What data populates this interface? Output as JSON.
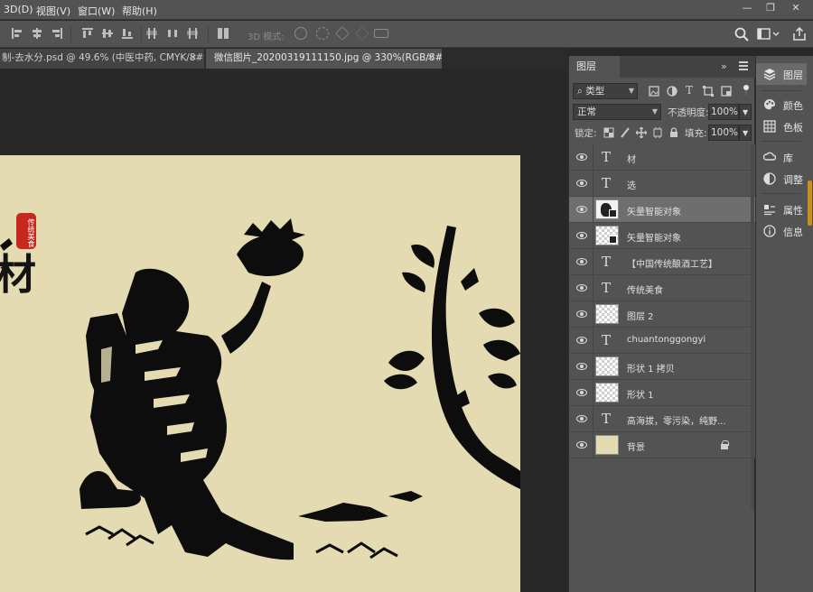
{
  "menu": {
    "items": [
      "3D(D)",
      "视图(V)",
      "窗口(W)",
      "帮助(H)"
    ]
  },
  "window_controls": {
    "minimize": "—",
    "restore": "❐",
    "close": "✕"
  },
  "options_bar": {
    "mode_3d_label": "3D 模式:"
  },
  "tabs": [
    {
      "label": "制-去水分.psd @ 49.6% (中医中药, CMYK/8#)",
      "close": "✕",
      "active": false
    },
    {
      "label": "微信图片_20200319111150.jpg @ 330%(RGB/8#) *",
      "close": "✕",
      "active": true
    }
  ],
  "document": {
    "title_text": "材",
    "seal_text": "传统美食",
    "background_color": "#e4dbb3"
  },
  "layers_panel": {
    "tab_label": "图层",
    "collapse_glyph": "»",
    "filter": {
      "label": "类型"
    },
    "blend_mode": "正常",
    "opacity_label": "不透明度:",
    "opacity_value": "100%",
    "lock_label": "锁定:",
    "fill_label": "填充:",
    "fill_value": "100%",
    "layers": [
      {
        "name": "材",
        "kind": "text",
        "selected": false
      },
      {
        "name": "选",
        "kind": "text",
        "selected": false
      },
      {
        "name": "矢量智能对象",
        "kind": "smart-art",
        "selected": true
      },
      {
        "name": "矢量智能对象",
        "kind": "smart",
        "selected": false
      },
      {
        "name": "【中国传统酿酒工艺】",
        "kind": "text",
        "selected": false
      },
      {
        "name": "传统美食",
        "kind": "text",
        "selected": false
      },
      {
        "name": "图层 2",
        "kind": "pixel",
        "selected": false
      },
      {
        "name": "chuantonggongyi",
        "kind": "text",
        "selected": false
      },
      {
        "name": "形状 1 拷贝",
        "kind": "shape",
        "selected": false
      },
      {
        "name": "形状 1",
        "kind": "shape",
        "selected": false
      },
      {
        "name": "高海拔，零污染，纯野...",
        "kind": "text",
        "selected": false
      },
      {
        "name": "背景",
        "kind": "background",
        "selected": false,
        "locked": true
      }
    ]
  },
  "right_dock": {
    "items": [
      {
        "label": "图层",
        "icon": "layers-icon",
        "active": true
      },
      {
        "label": "颜色",
        "icon": "color-palette-icon"
      },
      {
        "label": "色板",
        "icon": "swatches-icon"
      },
      {
        "label": "库",
        "icon": "libraries-icon"
      },
      {
        "label": "调整",
        "icon": "adjustments-icon"
      },
      {
        "label": "属性",
        "icon": "properties-icon"
      },
      {
        "label": "信息",
        "icon": "info-icon"
      }
    ]
  },
  "colors": {
    "ui_panel": "#535353",
    "ui_dark": "#282828",
    "selected_layer": "#6e6e6e",
    "scroll_accent": "#c98f16",
    "seal_red": "#c6281e"
  }
}
